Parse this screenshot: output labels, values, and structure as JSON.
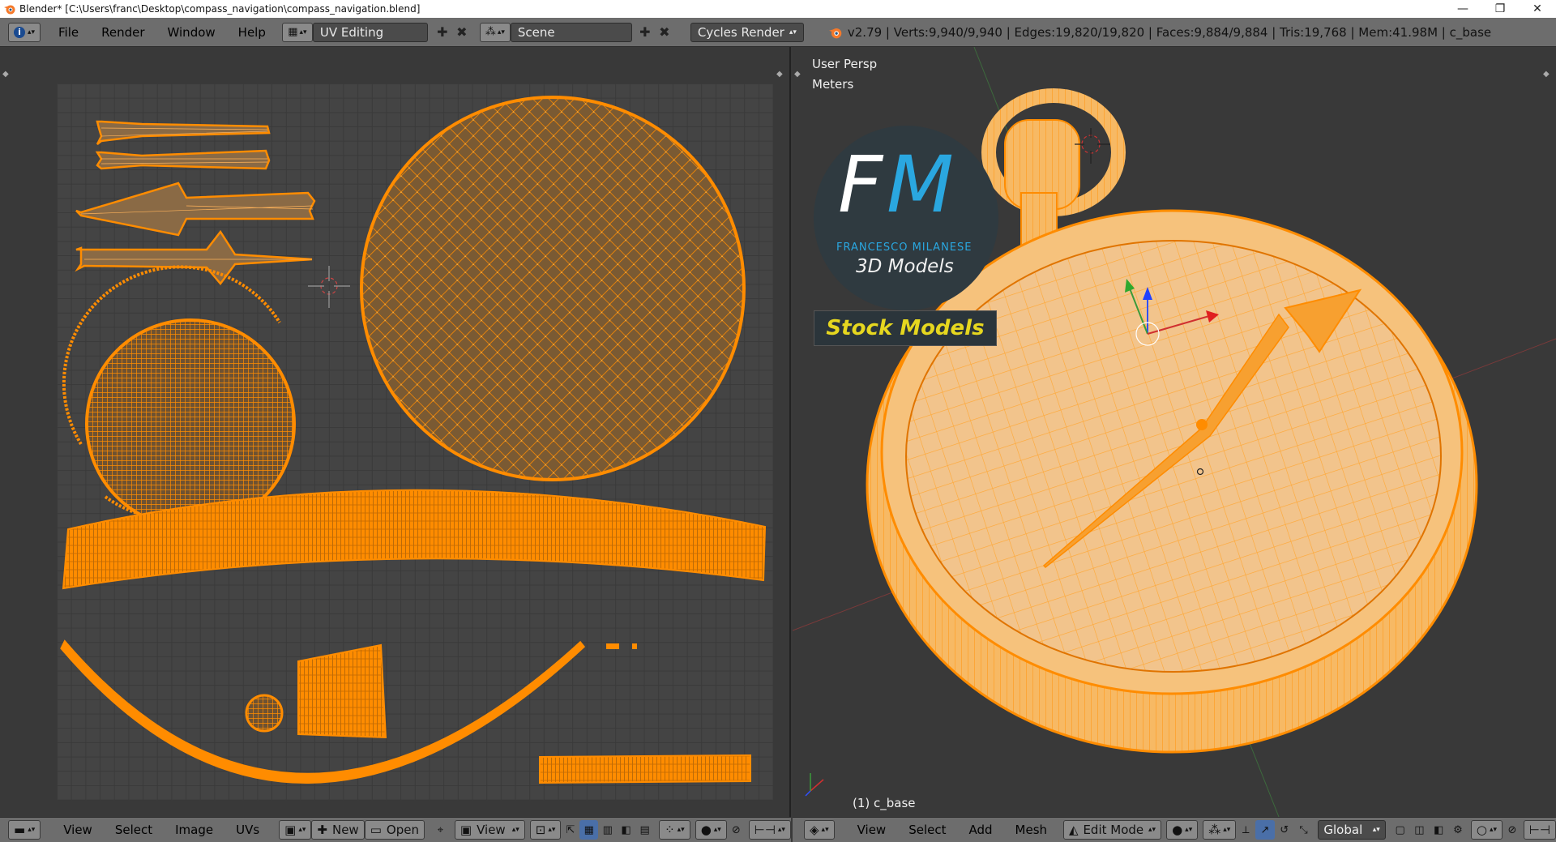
{
  "window": {
    "title": "Blender* [C:\\Users\\franc\\Desktop\\compass_navigation\\compass_navigation.blend]",
    "minimize": "—",
    "restore": "❐",
    "close": "✕"
  },
  "info_header": {
    "menus": [
      "File",
      "Render",
      "Window",
      "Help"
    ],
    "screen_layout": "UV Editing",
    "scene": "Scene",
    "render_engine": "Cycles Render",
    "stats": "v2.79 | Verts:9,940/9,940 | Edges:19,820/19,820 | Faces:9,884/9,884 | Tris:19,768 | Mem:41.98M | c_base"
  },
  "viewport": {
    "view_name": "User Persp",
    "units": "Meters",
    "object_label": "(1) c_base",
    "logo_initials_f": "F",
    "logo_initials_m": "M",
    "logo_name": "FRANCESCO MILANESE",
    "logo_subtitle": "3D Models",
    "stock_label": "Stock Models"
  },
  "uv_footer": {
    "menus": [
      "View",
      "Select",
      "Image",
      "UVs"
    ],
    "new_label": "New",
    "open_label": "Open",
    "view_label": "View"
  },
  "view3d_footer": {
    "menus": [
      "View",
      "Select",
      "Add",
      "Mesh"
    ],
    "mode": "Edit Mode",
    "orientation": "Global"
  },
  "colors": {
    "mesh_orange": "#ff8c00",
    "header_gray": "#6d6d6d",
    "background": "#393939"
  }
}
